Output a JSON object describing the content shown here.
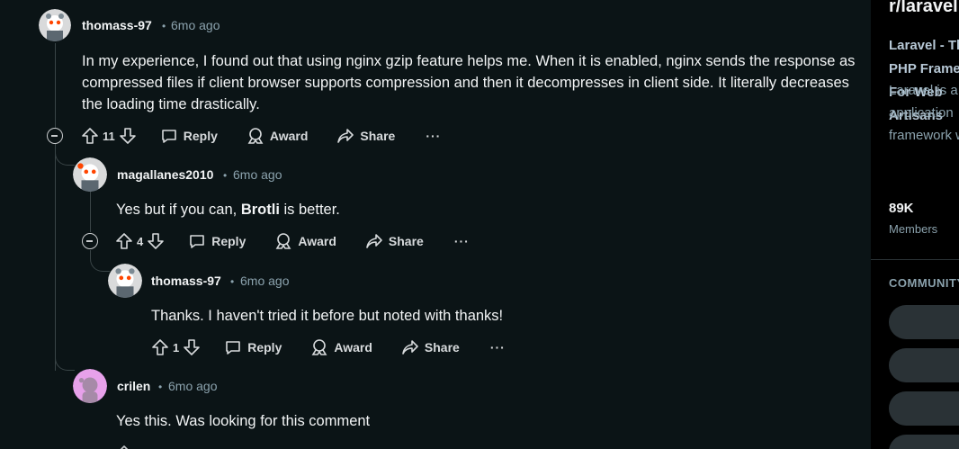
{
  "comments": [
    {
      "author": "thomass-97",
      "time": "6mo ago",
      "body": "In my experience, I found out that using nginx gzip feature helps me. When it is enabled, nginx sends the response as compressed files if client browser supports compression and then it decompresses in client side. It literally decreases the loading time drastically.",
      "votes": "11"
    },
    {
      "author": "magallanes2010",
      "time": "6mo ago",
      "body_pre": "Yes but if you can, ",
      "body_bold": "Brotli",
      "body_post": " is better.",
      "votes": "4"
    },
    {
      "author": "thomass-97",
      "time": "6mo ago",
      "body": "Thanks. I haven't tried it before but noted with thanks!",
      "votes": "1"
    },
    {
      "author": "crilen",
      "time": "6mo ago",
      "body": "Yes this. Was looking for this comment"
    }
  ],
  "actions": {
    "reply": "Reply",
    "award": "Award",
    "share": "Share",
    "more": "···"
  },
  "separator": "•",
  "sidebar": {
    "title": "r/laravel",
    "desc_title": "Laravel - The PHP Framework For Web Artisans",
    "desc": "Laravel is a web application framework with expressive, elegant syntax. We've already laid the foundation — freeing you to create without sweating the small things. features ex",
    "members_count": "89K",
    "members_label": "Members",
    "communities_label": "COMMUNITY BOOKMARKS"
  }
}
